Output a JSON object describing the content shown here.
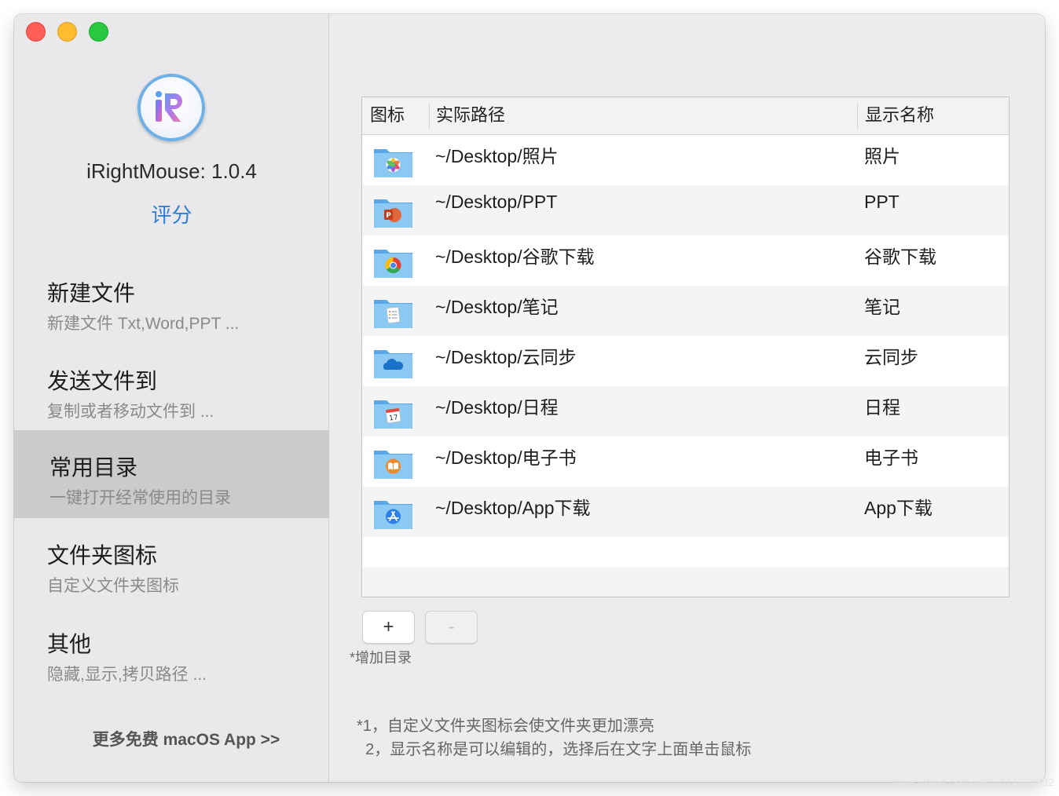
{
  "app": {
    "title": "iRightMouse: 1.0.4",
    "rate_label": "评分",
    "more_link": "更多免费 macOS App >>"
  },
  "sidebar": {
    "items": [
      {
        "title": "新建文件",
        "subtitle": "新建文件 Txt,Word,PPT ...",
        "selected": false
      },
      {
        "title": "发送文件到",
        "subtitle": "复制或者移动文件到 ...",
        "selected": false
      },
      {
        "title": "常用目录",
        "subtitle": "一键打开经常使用的目录",
        "selected": true
      },
      {
        "title": "文件夹图标",
        "subtitle": "自定义文件夹图标",
        "selected": false
      },
      {
        "title": "其他",
        "subtitle": "隐藏,显示,拷贝路径 ...",
        "selected": false
      }
    ]
  },
  "table": {
    "headers": {
      "icon": "图标",
      "path": "实际路径",
      "name": "显示名称"
    },
    "rows": [
      {
        "path": "~/Desktop/照片",
        "name": "照片",
        "icon": "photos-icon"
      },
      {
        "path": "~/Desktop/PPT",
        "name": "PPT",
        "icon": "powerpoint-icon"
      },
      {
        "path": "~/Desktop/谷歌下载",
        "name": "谷歌下载",
        "icon": "chrome-icon"
      },
      {
        "path": "~/Desktop/笔记",
        "name": "笔记",
        "icon": "notes-icon"
      },
      {
        "path": "~/Desktop/云同步",
        "name": "云同步",
        "icon": "cloud-icon"
      },
      {
        "path": "~/Desktop/日程",
        "name": "日程",
        "icon": "calendar-icon"
      },
      {
        "path": "~/Desktop/电子书",
        "name": "电子书",
        "icon": "books-icon"
      },
      {
        "path": "~/Desktop/App下载",
        "name": "App下载",
        "icon": "appstore-icon"
      }
    ]
  },
  "buttons": {
    "add": "+",
    "remove": "-",
    "add_hint": "*增加目录"
  },
  "notes": {
    "line1": "*1，自定义文件夹图标会使文件夹更加漂亮",
    "line2": "  2，显示名称是可以编辑的，选择后在文字上面单击鼠标"
  },
  "watermark": "https://blog.csdn.net/u014306892",
  "colors": {
    "accent": "#2f7ed8",
    "folder": "#6cb6ea",
    "selected_row": "#cbcacd"
  }
}
